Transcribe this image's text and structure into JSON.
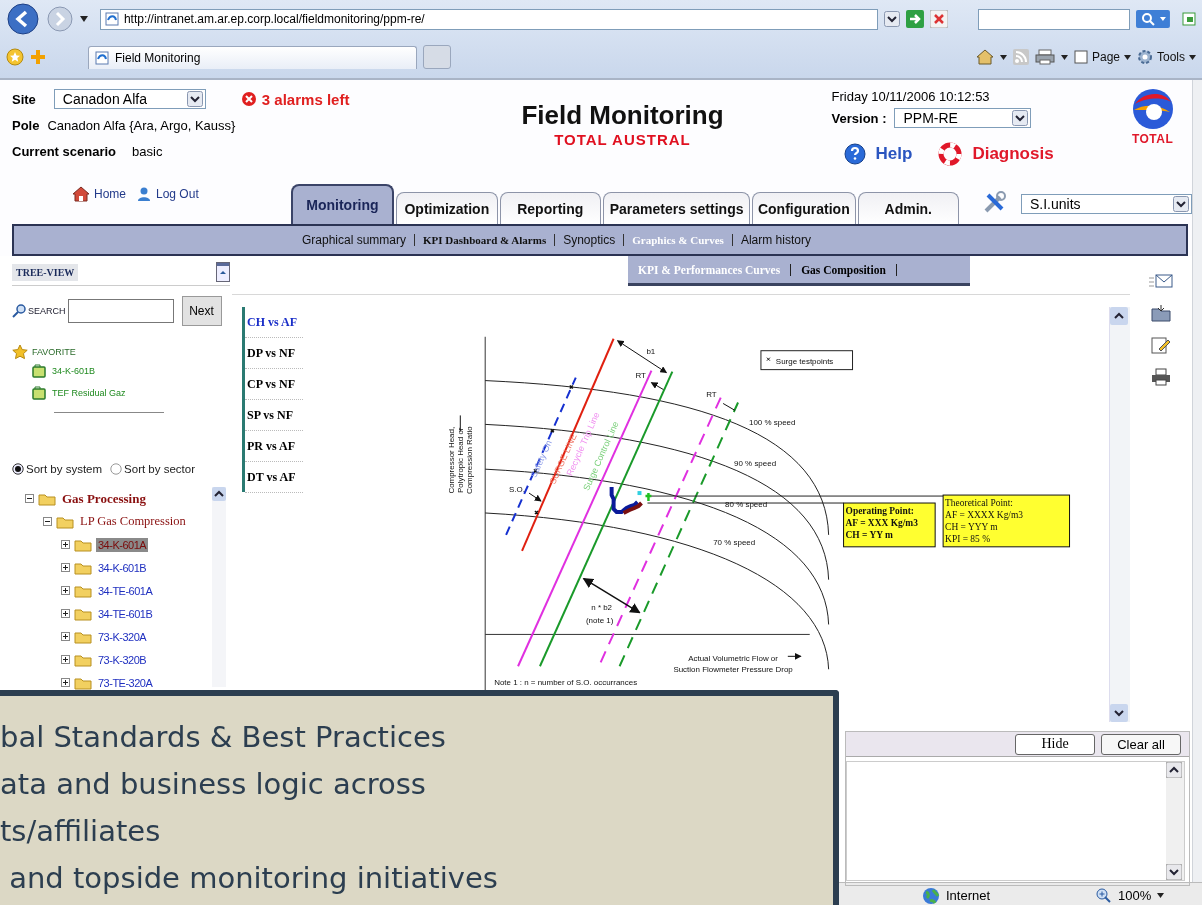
{
  "browser": {
    "address": "http://intranet.am.ar.ep.corp.local/fieldmonitoring/ppm-re/",
    "tab_title": "Field Monitoring",
    "tools": [
      {
        "label": "Page"
      },
      {
        "label": "Tools"
      }
    ]
  },
  "header": {
    "site_label": "Site",
    "site": "Canadon Alfa",
    "alarms": "3 alarms left",
    "pole_label": "Pole",
    "pole": "Canadon Alfa {Ara, Argo, Kauss}",
    "scenario_label": "Current scenario",
    "scenario": "basic",
    "title": "Field Monitoring",
    "subtitle": "TOTAL AUSTRAL",
    "datetime": "Friday 10/11/2006 10:12:53",
    "version_label": "Version :",
    "version": "PPM-RE",
    "help": "Help",
    "diagnosis": "Diagnosis",
    "logo": "TOTAL"
  },
  "links": [
    {
      "label": "Home"
    },
    {
      "label": "Log Out"
    }
  ],
  "tabs": [
    {
      "label": "Monitoring",
      "selected": true
    },
    {
      "label": "Optimization",
      "selected": false
    },
    {
      "label": "Reporting",
      "selected": false
    },
    {
      "label": "Parameters settings",
      "selected": false
    },
    {
      "label": "Configuration",
      "selected": false
    },
    {
      "label": "Admin.",
      "selected": false
    }
  ],
  "units": "S.I.units",
  "subnav": [
    {
      "label": "Graphical summary",
      "kind": "plain",
      "selected": false
    },
    {
      "label": "KPI Dashboard & Alarms",
      "kind": "serif",
      "selected": false
    },
    {
      "label": "Synoptics",
      "kind": "plain",
      "selected": false
    },
    {
      "label": "Graphics & Curves",
      "kind": "serif",
      "selected": true
    },
    {
      "label": "Alarm history",
      "kind": "plain",
      "selected": false
    }
  ],
  "submenu": [
    {
      "label": "KPI & Performances Curves",
      "selected": true
    },
    {
      "label": "Gas Composition",
      "selected": false
    }
  ],
  "tree": {
    "title": "TREE-VIEW",
    "search_label": "SEARCH",
    "next": "Next",
    "favorites_title": "FAVORITE",
    "favorites": [
      "34-K-601B",
      "TEF Residual Gaz"
    ],
    "sort": [
      {
        "label": "Sort by system",
        "selected": true
      },
      {
        "label": "Sort by sector",
        "selected": false
      }
    ],
    "nodes": [
      {
        "label": "Gas Processing",
        "expanded": true,
        "selected": false,
        "children": [
          {
            "label": "LP Gas Compression",
            "expanded": true,
            "selected": false,
            "children": [
              {
                "label": "34-K-601A",
                "expanded": false,
                "selected": true
              },
              {
                "label": "34-K-601B",
                "expanded": false,
                "selected": false
              },
              {
                "label": "34-TE-601A",
                "expanded": false,
                "selected": false
              },
              {
                "label": "34-TE-601B",
                "expanded": false,
                "selected": false
              },
              {
                "label": "73-K-320A",
                "expanded": false,
                "selected": false
              },
              {
                "label": "73-K-320B",
                "expanded": false,
                "selected": false
              },
              {
                "label": "73-TE-320A",
                "expanded": false,
                "selected": false
              }
            ]
          }
        ]
      }
    ]
  },
  "curves": [
    {
      "label": "CH vs AF",
      "selected": true
    },
    {
      "label": "DP vs NF",
      "selected": false
    },
    {
      "label": "CP vs NF",
      "selected": false
    },
    {
      "label": "SP vs NF",
      "selected": false
    },
    {
      "label": "PR vs AF",
      "selected": false
    },
    {
      "label": "DT vs AF",
      "selected": false
    }
  ],
  "diagram": {
    "legend": "Surge testpoints",
    "b1": "b1",
    "rt": [
      "RT",
      "RT"
    ],
    "so": "S.O.",
    "speeds": [
      "100 % speed",
      "90 % speed",
      "80 % speed",
      "70 % speed"
    ],
    "line_labels": [
      "Safety On",
      "SURGE LINE",
      "Recycle Trip Line",
      "Surge Control Line"
    ],
    "y_label": [
      "Compressor Head,",
      "Polytropic Head or",
      "Compression Ratio"
    ],
    "x_label": [
      "Actual Volumetric Flow or",
      "Suction Flowmeter Pressure Drop"
    ],
    "b2": "n * b2",
    "b2_note": "(note 1)",
    "note": "Note 1 : n = number of S.O. occurrances",
    "operating_point": [
      "Operating Point:",
      "AF = XXX Kg/m3",
      "CH = YY m"
    ],
    "theoretical_point": [
      "Theoretical Point:",
      "AF = XXXX Kg/m3",
      "CH = YYY m",
      "KPI = 85 %"
    ]
  },
  "log": {
    "buttons": [
      "Hide",
      "Clear all"
    ]
  },
  "status": {
    "zone": "Internet",
    "zoom": "100%"
  },
  "overlay": {
    "lines": [
      "bal Standards & Best Practices",
      "ata and business logic across",
      "ts/affiliates",
      " and topside monitoring initiatives"
    ]
  }
}
